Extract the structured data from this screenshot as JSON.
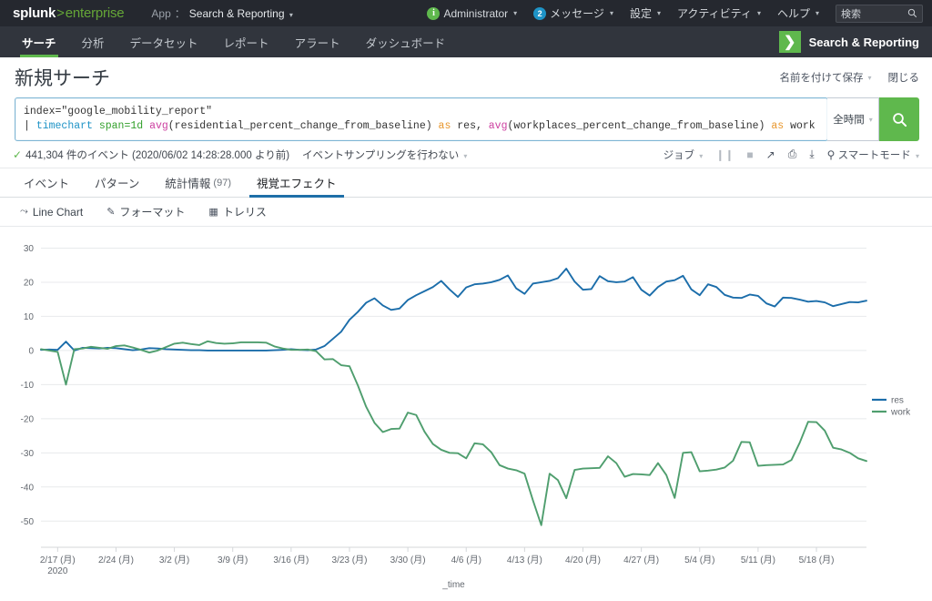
{
  "topbar": {
    "brand": {
      "splunk": "splunk",
      "gt": ">",
      "enterprise": "enterprise"
    },
    "app_label": "App",
    "app_separator": "：",
    "app_name": "Search & Reporting",
    "items": [
      {
        "badge": "i",
        "badge_type": "green",
        "label": "Administrator",
        "caret": "▾"
      },
      {
        "badge": "2",
        "badge_type": "blue",
        "label": "メッセージ",
        "caret": "▾"
      },
      {
        "badge": "",
        "badge_type": "none",
        "label": "設定",
        "caret": "▾"
      },
      {
        "badge": "",
        "badge_type": "none",
        "label": "アクティビティ",
        "caret": "▾"
      },
      {
        "badge": "",
        "badge_type": "none",
        "label": "ヘルプ",
        "caret": "▾"
      }
    ],
    "search_placeholder": "検索",
    "search_icon": "search-icon"
  },
  "navbar": {
    "items": [
      {
        "label": "サーチ",
        "active": true
      },
      {
        "label": "分析",
        "active": false
      },
      {
        "label": "データセット",
        "active": false
      },
      {
        "label": "レポート",
        "active": false
      },
      {
        "label": "アラート",
        "active": false
      },
      {
        "label": "ダッシュボード",
        "active": false
      }
    ],
    "app_badge_glyph": "❯",
    "app_badge_label": "Search & Reporting"
  },
  "page_header": {
    "title": "新規サーチ",
    "save_as_label": "名前を付けて保存",
    "save_as_caret": "▾",
    "close_label": "閉じる"
  },
  "search": {
    "query_line1": "index=\"google_mobility_report\"",
    "query_line2_pipe": "|",
    "query_line2_cmd": "timechart",
    "query_line2_span": "span=1d",
    "query_line2_fn1": "avg",
    "query_line2_arg1": "(residential_percent_change_from_baseline)",
    "query_line2_as1": "as",
    "query_line2_alias1": "res,",
    "query_line2_fn2": "avg",
    "query_line2_arg2": "(workplaces_percent_change_from_baseline)",
    "query_line2_as2": "as",
    "query_line2_alias2": "work",
    "time_range_label": "全時間",
    "time_range_caret": "▾",
    "search_button_icon": "search-icon"
  },
  "jobbar": {
    "check_icon": "checkmark-icon",
    "event_count_text": "441,304 件のイベント (2020/06/02 14:28:28.000 より前)",
    "sampling_label": "イベントサンプリングを行わない",
    "sampling_caret": "▾",
    "job_label": "ジョブ",
    "job_caret": "▾",
    "pause_icon": "pause-icon",
    "stop_icon": "stop-icon",
    "share_icon": "share-icon",
    "print_icon": "print-icon",
    "export_icon": "export-icon",
    "mode_icon": "lightbulb-icon",
    "mode_label": "スマートモード",
    "mode_caret": "▾"
  },
  "tabs": [
    {
      "label": "イベント",
      "count": "",
      "active": false
    },
    {
      "label": "パターン",
      "count": "",
      "active": false
    },
    {
      "label": "統計情報",
      "count": "(97)",
      "active": false
    },
    {
      "label": "視覚エフェクト",
      "count": "",
      "active": true
    }
  ],
  "viz_toolbar": [
    {
      "icon": "line-chart-icon",
      "glyph": "⤳",
      "label": "Line Chart"
    },
    {
      "icon": "format-icon",
      "glyph": "✎",
      "label": "フォーマット"
    },
    {
      "icon": "trellis-icon",
      "glyph": "▦",
      "label": "トレリス"
    }
  ],
  "colors": {
    "brand_green": "#5fb84d",
    "series_res": "#1b6daa",
    "series_work": "#4f9e6e",
    "accent_blue": "#1e6fa8",
    "grid": "#e8eaec"
  },
  "chart_data": {
    "type": "line",
    "title": "",
    "xlabel": "_time",
    "ylabel": "",
    "ylim": [
      -55,
      32
    ],
    "yticks": [
      30,
      20,
      10,
      0,
      -10,
      -20,
      -30,
      -40,
      -50
    ],
    "grid": true,
    "legend_position": "right",
    "xtick_labels": [
      "2/17 (月)",
      "2/24 (月)",
      "3/2 (月)",
      "3/9 (月)",
      "3/16 (月)",
      "3/23 (月)",
      "3/30 (月)",
      "4/6 (月)",
      "4/13 (月)",
      "4/20 (月)",
      "4/27 (月)",
      "5/4 (月)",
      "5/11 (月)",
      "5/18 (月)"
    ],
    "xtick_sublabel": "2020",
    "xtick_indices": [
      2,
      9,
      16,
      23,
      30,
      37,
      44,
      51,
      58,
      65,
      72,
      79,
      86,
      93
    ],
    "n_points": 100,
    "series": [
      {
        "name": "res",
        "color": "#1b6daa",
        "values": [
          0.2,
          0.3,
          0.2,
          2.6,
          0.0,
          0.8,
          0.7,
          0.6,
          0.8,
          0.7,
          0.4,
          0.1,
          0.3,
          0.7,
          0.6,
          0.4,
          0.3,
          0.2,
          0.1,
          0.1,
          0.0,
          0.0,
          0.0,
          0.0,
          0.0,
          0.0,
          0.0,
          0.0,
          0.1,
          0.2,
          0.4,
          0.2,
          0.1,
          0.3,
          1.3,
          3.4,
          5.5,
          9.0,
          11.3,
          14.0,
          15.3,
          13.2,
          11.9,
          12.3,
          14.8,
          16.2,
          17.4,
          18.6,
          20.4,
          17.9,
          15.7,
          18.5,
          19.4,
          19.6,
          20.0,
          20.7,
          22.0,
          18.2,
          16.6,
          19.6,
          20.0,
          20.4,
          21.2,
          24.0,
          20.2,
          17.8,
          18.0,
          21.8,
          20.3,
          20.0,
          20.2,
          21.5,
          17.8,
          16.1,
          18.6,
          20.2,
          20.6,
          21.9,
          17.9,
          16.2,
          19.4,
          18.6,
          16.3,
          15.5,
          15.4,
          16.4,
          16.0,
          13.8,
          12.9,
          15.5,
          15.4,
          14.9,
          14.3,
          14.5,
          14.1,
          13.0,
          13.6,
          14.2,
          14.1,
          14.6
        ]
      },
      {
        "name": "work",
        "color": "#4f9e6e",
        "values": [
          0.4,
          0.0,
          -0.4,
          -10.0,
          0.4,
          0.6,
          1.1,
          0.8,
          0.5,
          1.3,
          1.5,
          0.9,
          0.2,
          -0.6,
          0.0,
          1.0,
          2.0,
          2.3,
          1.9,
          1.6,
          2.7,
          2.2,
          2.0,
          2.1,
          2.4,
          2.4,
          2.4,
          2.3,
          1.2,
          0.6,
          0.2,
          0.2,
          0.3,
          -0.2,
          -2.6,
          -2.5,
          -4.3,
          -4.6,
          -10.2,
          -16.5,
          -21.2,
          -23.9,
          -23.0,
          -22.9,
          -18.2,
          -18.9,
          -23.8,
          -27.4,
          -29.1,
          -30.0,
          -30.1,
          -31.6,
          -27.2,
          -27.5,
          -29.8,
          -33.6,
          -34.6,
          -35.1,
          -36.1,
          -43.9,
          -51.2,
          -36.1,
          -38.0,
          -43.3,
          -35.0,
          -34.6,
          -34.5,
          -34.4,
          -31.0,
          -33.0,
          -37.0,
          -36.2,
          -36.3,
          -36.5,
          -33.0,
          -36.5,
          -43.2,
          -30.0,
          -29.8,
          -35.4,
          -35.2,
          -34.9,
          -34.3,
          -32.3,
          -26.8,
          -26.9,
          -33.8,
          -33.6,
          -33.5,
          -33.4,
          -32.1,
          -27.0,
          -20.9,
          -21.0,
          -23.5,
          -28.5,
          -29.0,
          -30.0,
          -31.6,
          -32.4
        ]
      }
    ]
  }
}
